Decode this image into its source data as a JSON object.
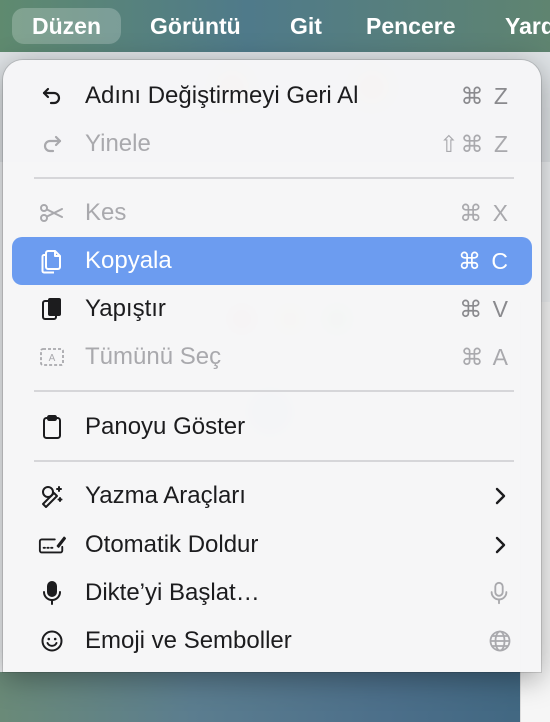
{
  "menubar": {
    "items": [
      {
        "label": "Düzen",
        "active": true
      },
      {
        "label": "Görüntü"
      },
      {
        "label": "Git"
      },
      {
        "label": "Pencere"
      },
      {
        "label": "Yard"
      }
    ]
  },
  "menu": {
    "undo": {
      "label": "Adını Değiştirmeyi Geri Al",
      "shortcut": "⌘ Z",
      "icon": "undo-icon"
    },
    "redo": {
      "label": "Yinele",
      "shortcut": "⇧⌘ Z",
      "icon": "redo-icon",
      "disabled": true
    },
    "cut": {
      "label": "Kes",
      "shortcut": "⌘ X",
      "icon": "scissors-icon",
      "disabled": true
    },
    "copy": {
      "label": "Kopyala",
      "shortcut": "⌘ C",
      "icon": "copy-icon",
      "highlighted": true
    },
    "paste": {
      "label": "Yapıştır",
      "shortcut": "⌘ V",
      "icon": "paste-icon"
    },
    "select_all": {
      "label": "Tümünü Seç",
      "shortcut": "⌘ A",
      "icon": "select-all-icon",
      "disabled": true
    },
    "show_clipboard": {
      "label": "Panoyu Göster",
      "icon": "clipboard-icon"
    },
    "writing_tools": {
      "label": "Yazma Araçları",
      "icon": "writing-tools-icon",
      "submenu": true
    },
    "autofill": {
      "label": "Otomatik Doldur",
      "icon": "autofill-icon",
      "submenu": true
    },
    "dictation": {
      "label": "Dikte’yi Başlat…",
      "icon": "microphone-icon",
      "trailing_icon": "microphone-icon"
    },
    "emoji": {
      "label": "Emoji ve Semboller",
      "icon": "smiley-icon",
      "trailing_icon": "globe-icon"
    }
  },
  "colors": {
    "highlight": "#6c9cf0",
    "text": "#1c1c1e",
    "disabled": "#a9a9ad"
  }
}
